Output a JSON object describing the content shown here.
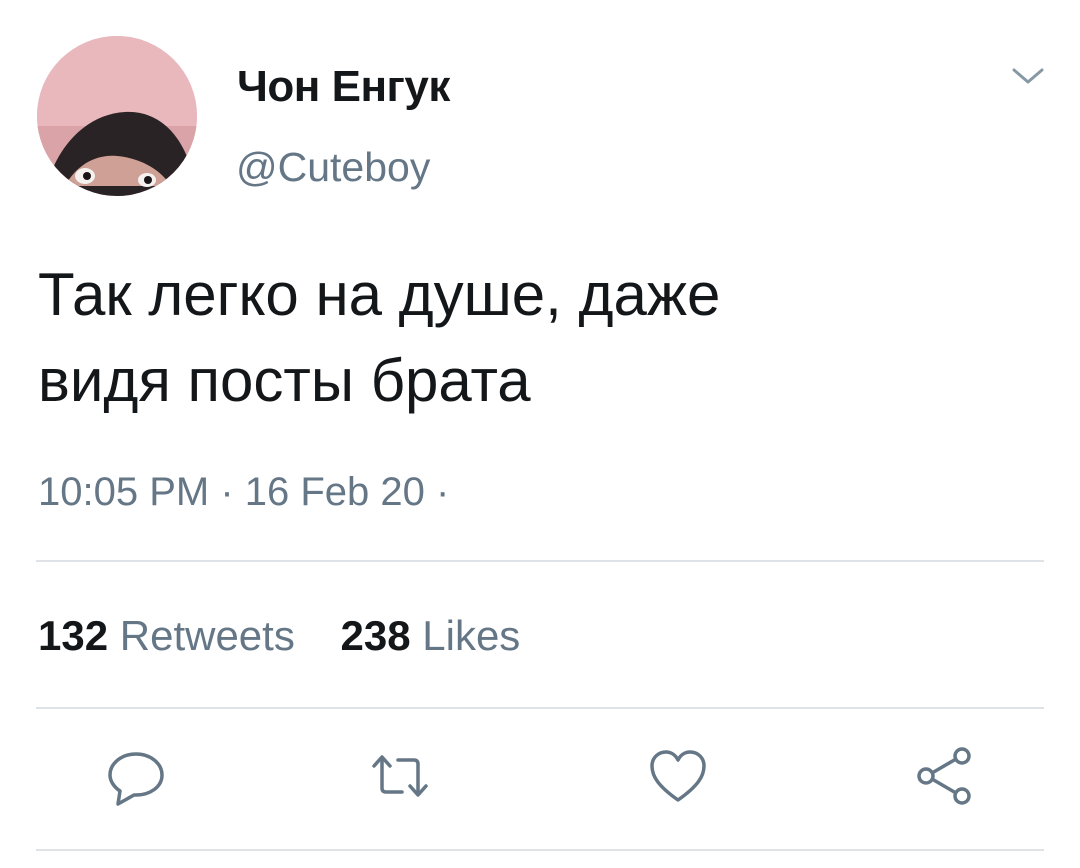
{
  "tweet": {
    "author": {
      "display_name": "Чон Енгук",
      "handle": "@Cuteboy"
    },
    "text_lines": [
      "Так легко на душе, даже",
      "видя посты брата"
    ],
    "time": "10:05 PM",
    "separator": " · ",
    "date": "16 Feb 20",
    "trailing_separator": " ·"
  },
  "stats": {
    "retweets": {
      "count": "132",
      "label": "Retweets"
    },
    "likes": {
      "count": "238",
      "label": "Likes"
    }
  },
  "actions": [
    "reply-icon",
    "retweet-icon",
    "like-icon",
    "share-icon"
  ],
  "colors": {
    "text": "#14171a",
    "secondary": "#657786",
    "divider": "#dfe3e8"
  }
}
